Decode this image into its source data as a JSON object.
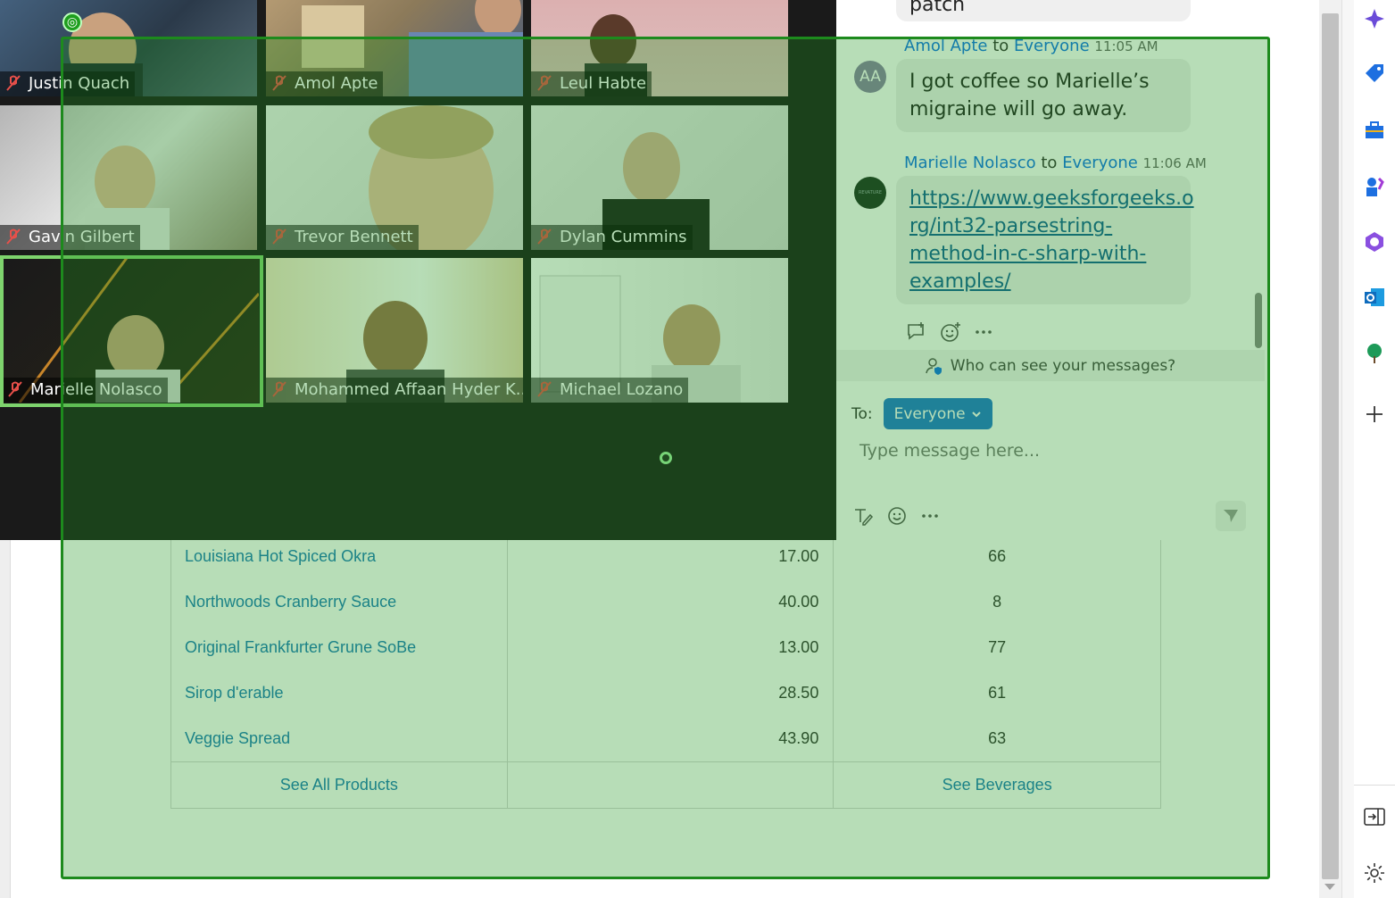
{
  "products_table": {
    "rows": [
      {
        "name": "Louisiana Hot Spiced Okra",
        "price": "17.00",
        "qty": "66"
      },
      {
        "name": "Northwoods Cranberry Sauce",
        "price": "40.00",
        "qty": "8"
      },
      {
        "name": "Original Frankfurter Grune SoBe",
        "price": "13.00",
        "qty": "77"
      },
      {
        "name": "Sirop d'erable",
        "price": "28.50",
        "qty": "61"
      },
      {
        "name": "Veggie Spread",
        "price": "43.90",
        "qty": "63"
      }
    ],
    "footer": {
      "see_all_label": "See All Products",
      "see_beverages_label": "See Beverages"
    }
  },
  "meeting": {
    "participants": [
      {
        "name": "Justin Quach",
        "muted": true
      },
      {
        "name": "Amol Apte",
        "muted": true
      },
      {
        "name": "Leul Habte",
        "muted": true
      },
      {
        "name": "Gavin Gilbert",
        "muted": true
      },
      {
        "name": "Trevor Bennett",
        "muted": true
      },
      {
        "name": "Dylan Cummins",
        "muted": true
      },
      {
        "name": "Marielle Nolasco",
        "muted": true,
        "active_speaker": true
      },
      {
        "name": "Mohammed Affaan Hyder K...",
        "muted": true
      },
      {
        "name": "Michael Lozano",
        "muted": true
      }
    ]
  },
  "chat": {
    "partial_prev_message": "patch",
    "messages": [
      {
        "sender": "Amol Apte",
        "to_word": "to",
        "recipient": "Everyone",
        "time": "11:05 AM",
        "avatar_initials": "AA",
        "text": "I got coffee so Marielle’s migraine will go away."
      },
      {
        "sender": "Marielle Nolasco",
        "to_word": "to",
        "recipient": "Everyone",
        "time": "11:06 AM",
        "avatar_initials": "REVATURE",
        "link": "https://www.geeksforgeeks.org/int32-parsestring-method-in-c-sharp-with-examples/",
        "link_lines": [
          "https://www.geeksforgeeks.o",
          "rg/int32-parsestring-",
          "method-in-c-sharp-with-",
          "examples/"
        ]
      }
    ],
    "who_can_see_label": "Who can see your messages?",
    "to_label": "To:",
    "to_value": "Everyone",
    "input_placeholder": "Type message here..."
  },
  "sidebar_icons": [
    "copilot-icon",
    "tag-icon",
    "toolbox-icon",
    "games-icon",
    "m365-icon",
    "outlook-icon",
    "tree-icon",
    "add-icon",
    "split-screen-icon",
    "settings-icon"
  ],
  "colors": {
    "selection_tint": "#1e961e",
    "zoom_blue": "#0e71eb",
    "link_blue": "#1a7ab8",
    "active_speaker": "#7ed36d"
  }
}
